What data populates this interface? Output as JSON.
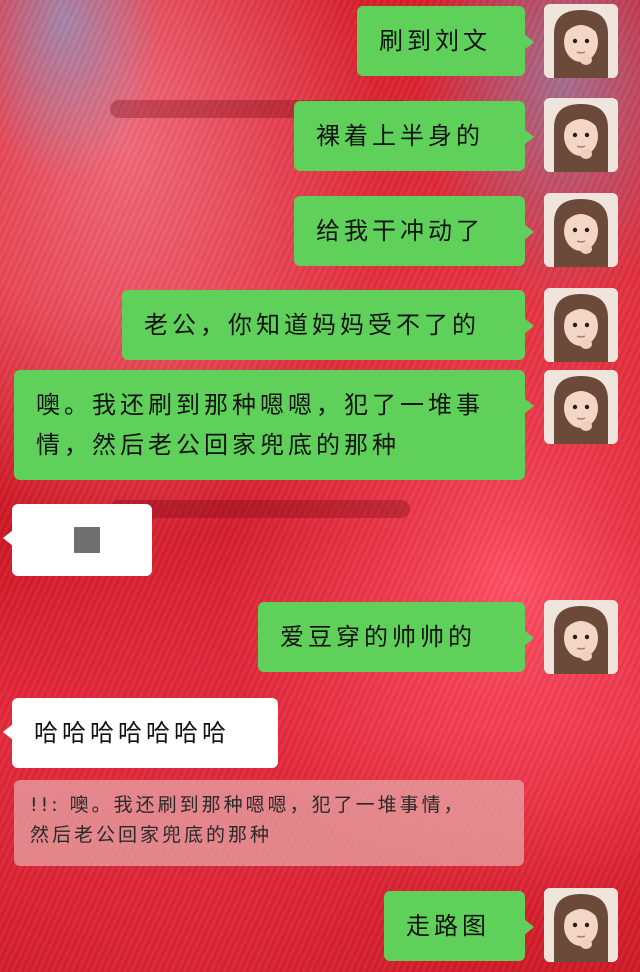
{
  "theme": {
    "bubble_green": "#5fd15a",
    "bubble_white": "#ffffff",
    "background": "#d81e2c"
  },
  "messages": [
    {
      "side": "right",
      "text": "刷到刘文",
      "avatar": "girl-avatar"
    },
    {
      "side": "right",
      "text": "裸着上半身的",
      "avatar": "girl-avatar"
    },
    {
      "side": "right",
      "text": "给我干冲动了",
      "avatar": "girl-avatar"
    },
    {
      "side": "right",
      "text": "老公，你知道妈妈受不了的",
      "avatar": "girl-avatar"
    },
    {
      "side": "right",
      "text_line1": "噢。我还刷到那种嗯嗯，犯了一堆事",
      "text_line2": "情，然后老公回家兜底的那种",
      "avatar": "girl-avatar"
    },
    {
      "side": "left",
      "type": "sticker",
      "icon": "image-placeholder-icon"
    },
    {
      "side": "right",
      "text": "爱豆穿的帅帅的",
      "avatar": "girl-avatar"
    },
    {
      "side": "left",
      "text": "哈哈哈哈哈哈哈"
    },
    {
      "side": "right",
      "text": "走路图",
      "avatar": "girl-avatar"
    }
  ],
  "quote": {
    "line1": "!!: 噢。我还刷到那种嗯嗯，犯了一堆事情，",
    "line2": "然后老公回家兜底的那种"
  }
}
